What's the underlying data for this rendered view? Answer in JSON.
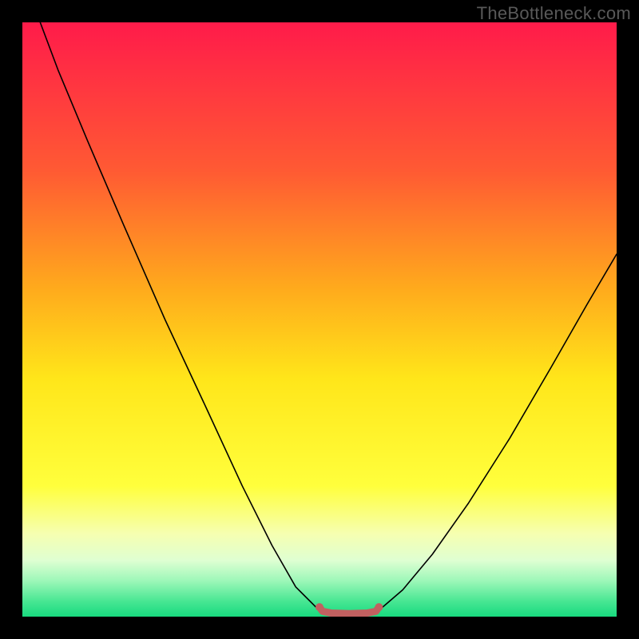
{
  "watermark_text": "TheBottleneck.com",
  "chart_data": {
    "type": "line",
    "title": "",
    "xlabel": "",
    "ylabel": "",
    "xlim": [
      0,
      100
    ],
    "ylim": [
      0,
      100
    ],
    "gradient_stops": [
      {
        "offset": 0.0,
        "color": "#ff1b4a"
      },
      {
        "offset": 0.25,
        "color": "#ff5a33"
      },
      {
        "offset": 0.45,
        "color": "#ffab1c"
      },
      {
        "offset": 0.6,
        "color": "#ffe61a"
      },
      {
        "offset": 0.78,
        "color": "#ffff3c"
      },
      {
        "offset": 0.86,
        "color": "#f6ffb0"
      },
      {
        "offset": 0.905,
        "color": "#dfffd2"
      },
      {
        "offset": 0.94,
        "color": "#9cf7b8"
      },
      {
        "offset": 0.975,
        "color": "#46e692"
      },
      {
        "offset": 1.0,
        "color": "#18da7f"
      }
    ],
    "series": [
      {
        "name": "bottleneck-curve",
        "stroke": "#000000",
        "stroke_width": 1.6,
        "points": [
          {
            "x": 3.0,
            "y": 100.0
          },
          {
            "x": 6.0,
            "y": 92.0
          },
          {
            "x": 11.0,
            "y": 80.0
          },
          {
            "x": 17.0,
            "y": 66.0
          },
          {
            "x": 24.0,
            "y": 50.0
          },
          {
            "x": 31.0,
            "y": 35.0
          },
          {
            "x": 37.0,
            "y": 22.0
          },
          {
            "x": 42.0,
            "y": 12.0
          },
          {
            "x": 46.0,
            "y": 5.0
          },
          {
            "x": 49.5,
            "y": 1.5
          },
          {
            "x": 53.0,
            "y": 0.6
          },
          {
            "x": 57.0,
            "y": 0.6
          },
          {
            "x": 60.5,
            "y": 1.5
          },
          {
            "x": 64.0,
            "y": 4.5
          },
          {
            "x": 69.0,
            "y": 10.5
          },
          {
            "x": 75.0,
            "y": 19.0
          },
          {
            "x": 82.0,
            "y": 30.0
          },
          {
            "x": 89.0,
            "y": 42.0
          },
          {
            "x": 95.0,
            "y": 52.5
          },
          {
            "x": 100.0,
            "y": 61.0
          }
        ]
      },
      {
        "name": "optimal-range-marker",
        "stroke": "#c16060",
        "stroke_width": 9,
        "points": [
          {
            "x": 50.0,
            "y": 1.6
          },
          {
            "x": 50.5,
            "y": 0.9
          },
          {
            "x": 52.0,
            "y": 0.6
          },
          {
            "x": 55.0,
            "y": 0.5
          },
          {
            "x": 58.0,
            "y": 0.6
          },
          {
            "x": 59.5,
            "y": 0.9
          },
          {
            "x": 60.0,
            "y": 1.6
          }
        ]
      }
    ]
  }
}
